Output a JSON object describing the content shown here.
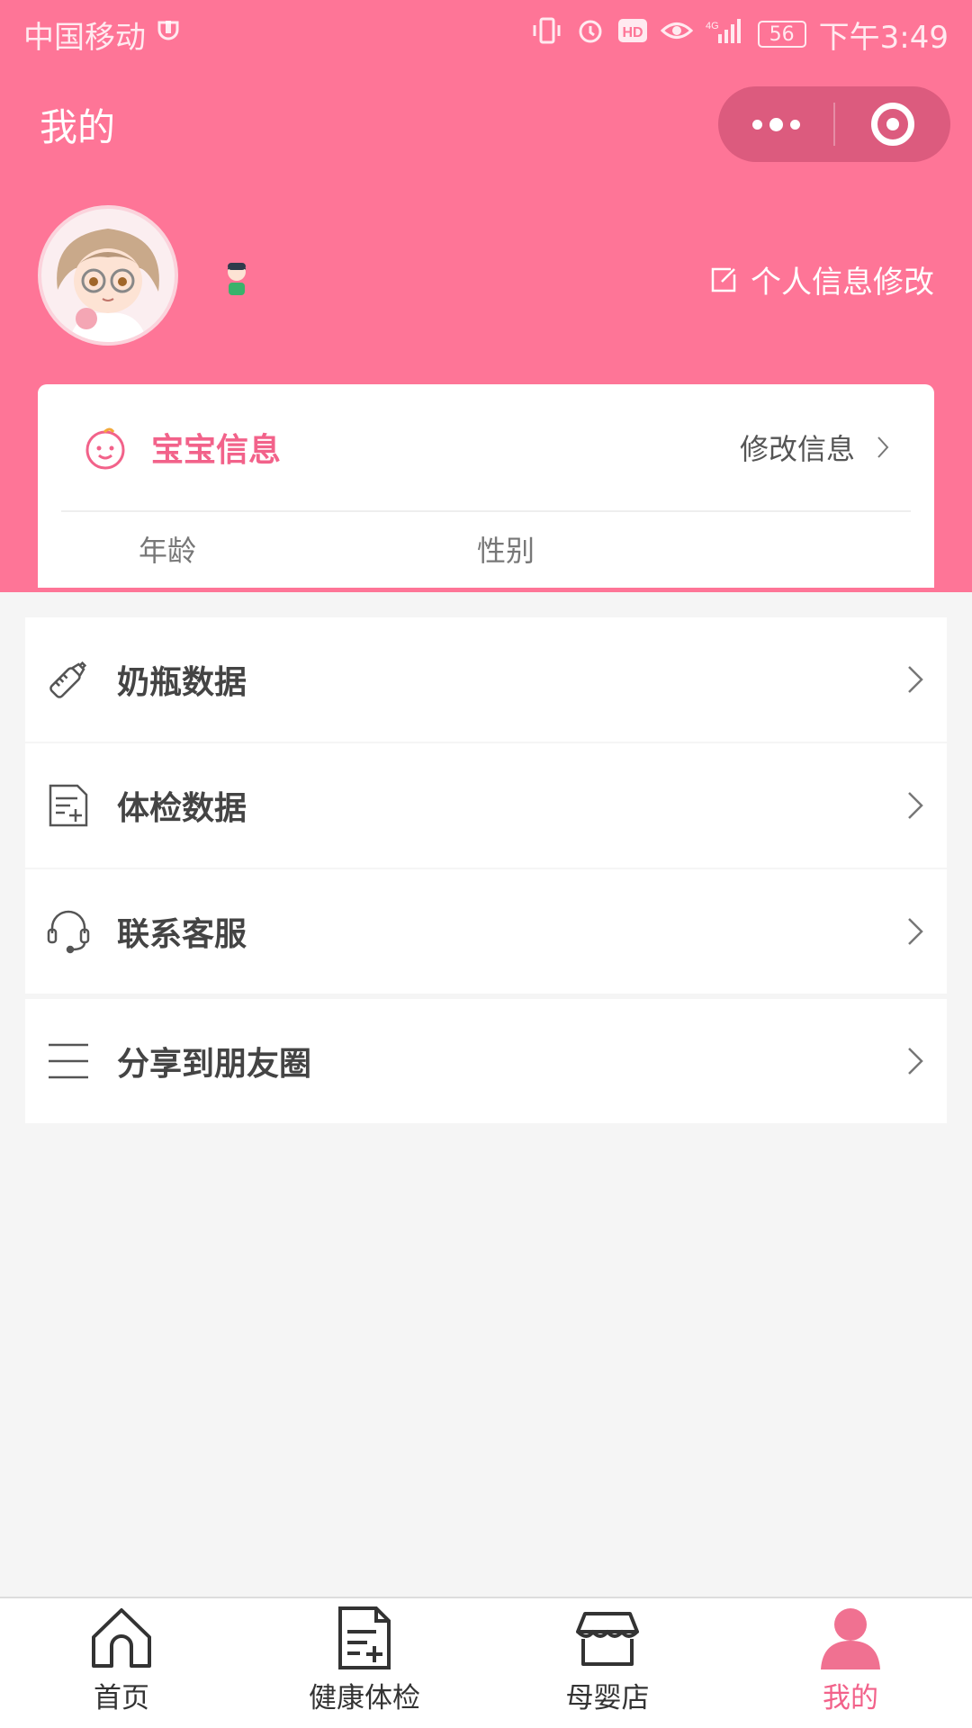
{
  "status_bar": {
    "carrier": "中国移动",
    "battery": "56",
    "time": "下午3:49"
  },
  "navbar": {
    "title": "我的"
  },
  "profile": {
    "edit_label": "个人信息修改"
  },
  "baby_card": {
    "title": "宝宝信息",
    "edit_label": "修改信息",
    "fields": [
      "年龄",
      "性别"
    ]
  },
  "menu": {
    "items": [
      {
        "label": "奶瓶数据",
        "icon": "baby-bottle-icon"
      },
      {
        "label": "体检数据",
        "icon": "checkup-document-icon"
      },
      {
        "label": "联系客服",
        "icon": "headset-icon"
      },
      {
        "label": "分享到朋友圈",
        "icon": "menu-lines-icon"
      }
    ]
  },
  "tabbar": {
    "items": [
      {
        "label": "首页",
        "icon": "home-icon",
        "active": false
      },
      {
        "label": "健康体检",
        "icon": "document-add-icon",
        "active": false
      },
      {
        "label": "母婴店",
        "icon": "store-icon",
        "active": false
      },
      {
        "label": "我的",
        "icon": "user-icon",
        "active": true
      }
    ]
  },
  "colors": {
    "primary": "#fe7597",
    "accent_text": "#f2628a",
    "background": "#f5f5f5"
  }
}
